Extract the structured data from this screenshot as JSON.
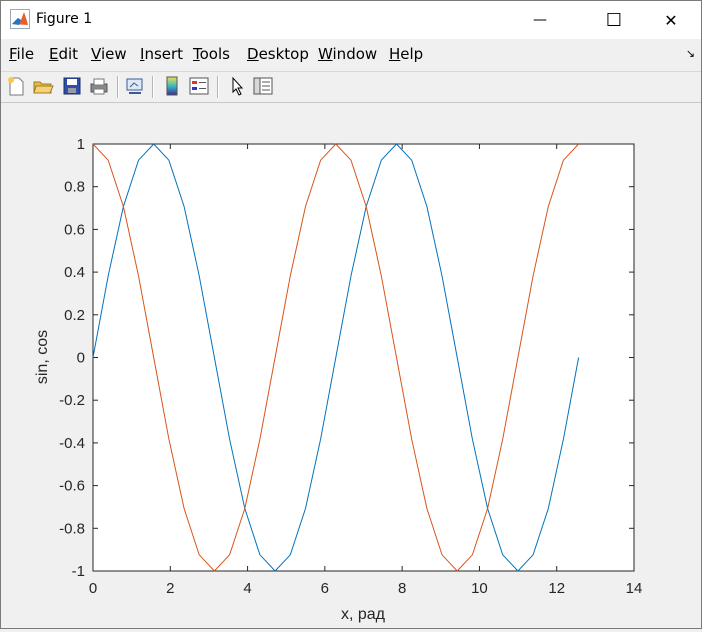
{
  "window": {
    "title": "Figure 1",
    "minimize_glyph": "—",
    "maximize_glyph": "☐",
    "close_glyph": "✕"
  },
  "menu": [
    {
      "label": "File",
      "u": "F",
      "rest": "ile"
    },
    {
      "label": "Edit",
      "u": "E",
      "rest": "dit"
    },
    {
      "label": "View",
      "u": "V",
      "rest": "iew"
    },
    {
      "label": "Insert",
      "u": "I",
      "rest": "nsert"
    },
    {
      "label": "Tools",
      "u": "T",
      "rest": "ools"
    },
    {
      "label": "Desktop",
      "u": "D",
      "rest": "esktop"
    },
    {
      "label": "Window",
      "u": "W",
      "rest": "indow"
    },
    {
      "label": "Help",
      "u": "H",
      "rest": "elp"
    }
  ],
  "toolbar": {
    "icons": [
      "new-figure-icon",
      "open-file-icon",
      "save-icon",
      "print-icon",
      "link-plot-icon",
      "colorbar-icon",
      "legend-icon",
      "pointer-icon",
      "property-inspector-icon"
    ]
  },
  "colors": {
    "series1": "#0072bd",
    "series2": "#d95319"
  },
  "chart_data": {
    "type": "line",
    "xlabel": "x, рад",
    "ylabel": "sin, cos",
    "xlim": [
      0,
      14
    ],
    "ylim": [
      -1,
      1
    ],
    "xticks": [
      "0",
      "2",
      "4",
      "6",
      "8",
      "10",
      "12",
      "14"
    ],
    "yticks": [
      "1",
      "0.8",
      "0.6",
      "0.4",
      "0.2",
      "0",
      "-0.2",
      "-0.4",
      "-0.6",
      "-0.8",
      "-1"
    ],
    "grid": false,
    "x": [
      0,
      0.3927,
      0.7854,
      1.1781,
      1.5708,
      1.9635,
      2.3562,
      2.7489,
      3.1416,
      3.5343,
      3.927,
      4.3197,
      4.7124,
      5.1051,
      5.4978,
      5.8905,
      6.2832,
      6.6759,
      7.0686,
      7.4613,
      7.854,
      8.2467,
      8.6394,
      9.0321,
      9.4248,
      9.8175,
      10.2102,
      10.6029,
      10.9956,
      11.3883,
      11.781,
      12.1737,
      12.5664
    ],
    "series": [
      {
        "values": [
          0,
          0.3827,
          0.7071,
          0.9239,
          1,
          0.9239,
          0.7071,
          0.3827,
          0,
          -0.3827,
          -0.7071,
          -0.9239,
          -1,
          -0.9239,
          -0.7071,
          -0.3827,
          0,
          0.3827,
          0.7071,
          0.9239,
          1,
          0.9239,
          0.7071,
          0.3827,
          0,
          -0.3827,
          -0.7071,
          -0.9239,
          -1,
          -0.9239,
          -0.7071,
          -0.3827,
          0
        ]
      },
      {
        "values": [
          1,
          0.9239,
          0.7071,
          0.3827,
          0,
          -0.3827,
          -0.7071,
          -0.9239,
          -1,
          -0.9239,
          -0.7071,
          -0.3827,
          0,
          0.3827,
          0.7071,
          0.9239,
          1,
          0.9239,
          0.7071,
          0.3827,
          0,
          -0.3827,
          -0.7071,
          -0.9239,
          -1,
          -0.9239,
          -0.7071,
          -0.3827,
          0,
          0.3827,
          0.7071,
          0.9239,
          1
        ]
      }
    ]
  }
}
